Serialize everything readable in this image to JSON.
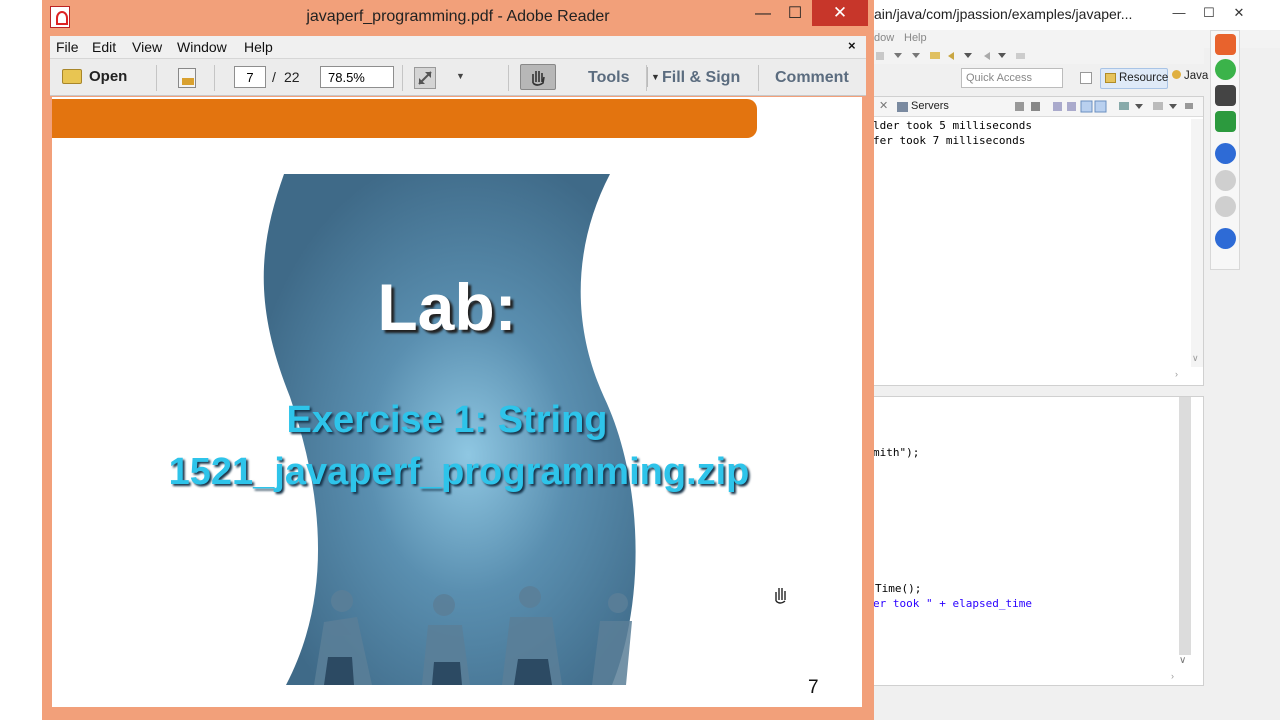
{
  "reader": {
    "window_title": "javaperf_programming.pdf - Adobe Reader",
    "menu": [
      "File",
      "Edit",
      "View",
      "Window",
      "Help"
    ],
    "menu_close": "×",
    "toolbar": {
      "open_label": "Open",
      "current_page": "7",
      "page_separator": "/",
      "total_pages": "22",
      "zoom": "78.5%",
      "tools_label": "Tools",
      "fill_sign_label": "Fill & Sign",
      "comment_label": "Comment"
    },
    "slide": {
      "title": "Lab:",
      "line1": "Exercise 1: String",
      "line2": "1521_javaperf_programming.zip",
      "page_number": "7"
    },
    "colors": {
      "frame": "#f2a07a",
      "close": "#c7362a",
      "band": "#e3740f",
      "exercise_text": "#2ec4ea"
    }
  },
  "eclipse": {
    "title": "ain/java/com/jpassion/examples/javaper...",
    "menu": [
      "dow",
      "Help"
    ],
    "quick_access_placeholder": "Quick Access",
    "perspective_resource": "Resource",
    "perspective_java": "Java",
    "servers_tab": "Servers",
    "console_lines": [
      "lder took 5 milliseconds",
      "fer took 7 milliseconds"
    ],
    "editor_lines": [
      "mith\");",
      "Time();",
      "er took \" + elapsed_time"
    ]
  }
}
